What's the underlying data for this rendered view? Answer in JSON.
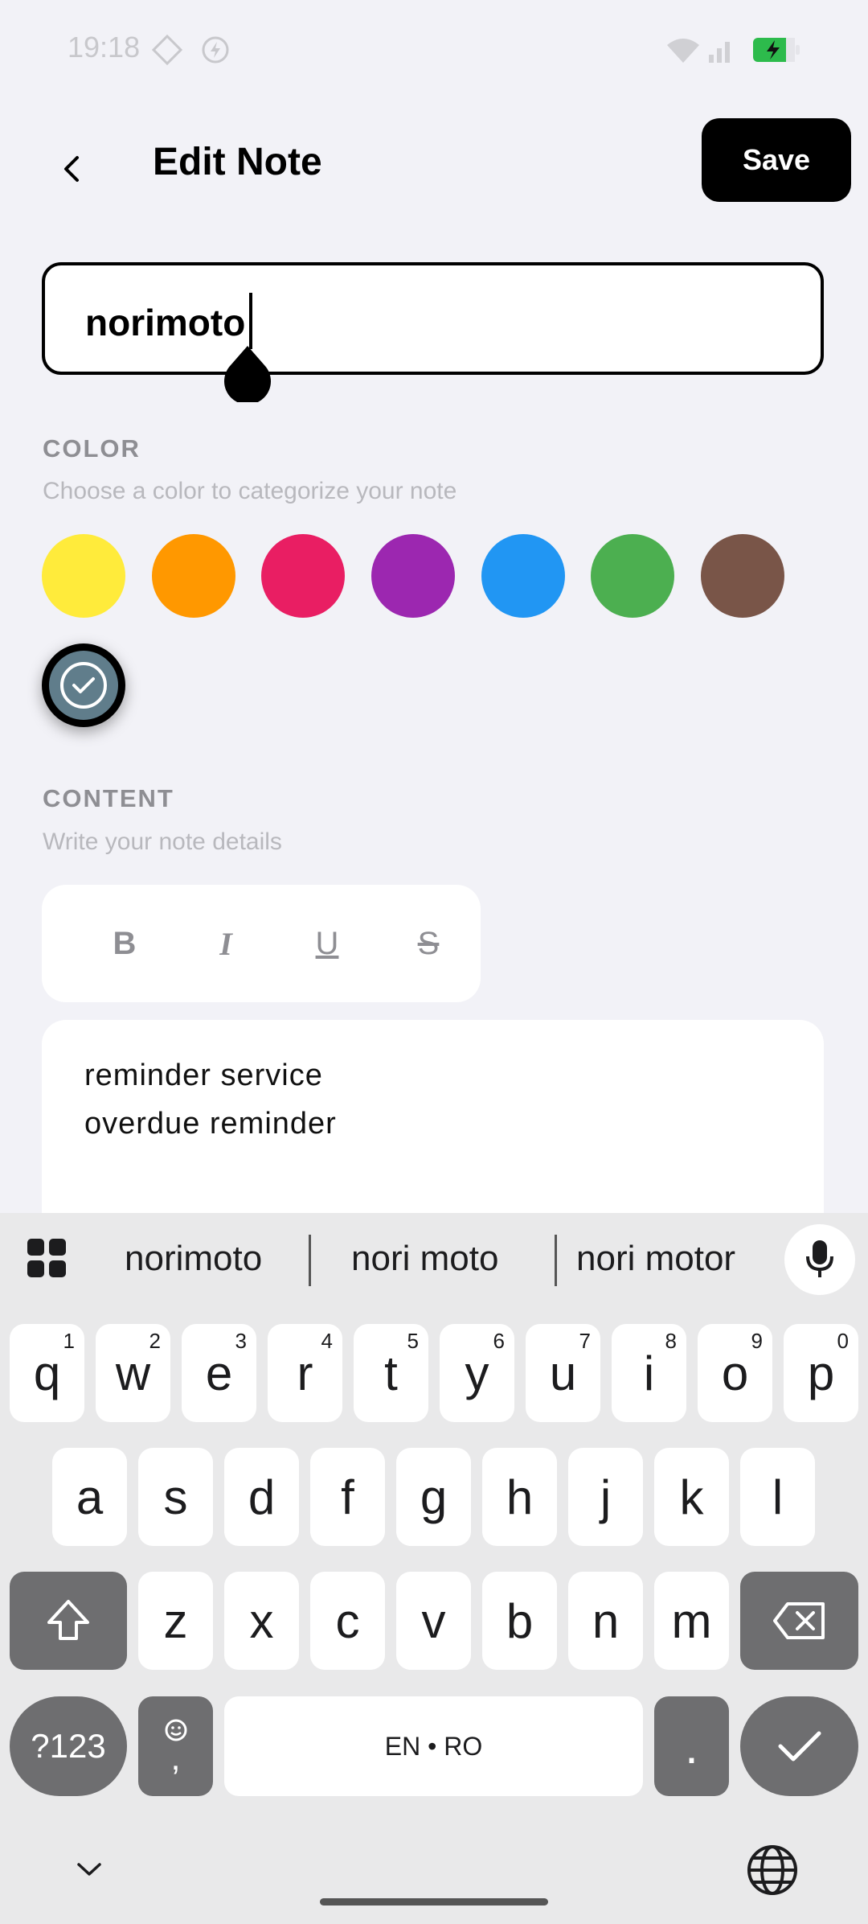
{
  "status_bar": {
    "time": "19:18"
  },
  "header": {
    "title": "Edit Note",
    "save_label": "Save"
  },
  "title_field": {
    "value": "norimoto"
  },
  "color_section": {
    "label": "COLOR",
    "hint": "Choose a color to categorize your note",
    "colors": [
      "#ffeb3b",
      "#ff9800",
      "#e91e63",
      "#9c27b0",
      "#2196f3",
      "#4caf50",
      "#795548",
      "#607d8b"
    ],
    "selected_color": "#607d8b"
  },
  "content_section": {
    "label": "CONTENT",
    "hint": "Write your note details",
    "format_buttons": [
      "B",
      "I",
      "U",
      "S"
    ],
    "lines": [
      "reminder service",
      "overdue reminder"
    ]
  },
  "keyboard": {
    "suggestions": [
      "norimoto",
      "nori moto",
      "nori motor"
    ],
    "row1": [
      "q",
      "w",
      "e",
      "r",
      "t",
      "y",
      "u",
      "i",
      "o",
      "p"
    ],
    "row1_hints": [
      "1",
      "2",
      "3",
      "4",
      "5",
      "6",
      "7",
      "8",
      "9",
      "0"
    ],
    "row2": [
      "a",
      "s",
      "d",
      "f",
      "g",
      "h",
      "j",
      "k",
      "l"
    ],
    "row3": [
      "z",
      "x",
      "c",
      "v",
      "b",
      "n",
      "m"
    ],
    "symbols_label": "?123",
    "comma_label": ",",
    "space_label": "EN • RO",
    "period_label": "."
  }
}
